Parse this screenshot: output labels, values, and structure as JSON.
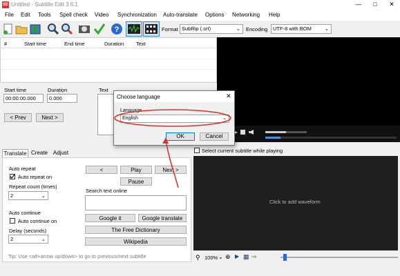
{
  "window": {
    "title": "Untitled - Subtitle Edit 3.6.1"
  },
  "menu": [
    "File",
    "Edit",
    "Tools",
    "Spell check",
    "Video",
    "Synchronization",
    "Auto-translate",
    "Options",
    "Networking",
    "Help"
  ],
  "toolbar": {
    "format_label": "Format",
    "format_value": "SubRip (.srt)",
    "encoding_label": "Encoding",
    "encoding_value": "UTF-8 with BOM",
    "icons": [
      "new-file-icon",
      "open-folder-icon",
      "save-icon",
      "find-icon",
      "replace-icon",
      "visual-sync-icon",
      "spell-check-icon",
      "help-icon",
      "waveform-icon",
      "video-icon"
    ]
  },
  "grid": {
    "columns": [
      "#",
      "Start time",
      "End time",
      "Duration",
      "Text"
    ]
  },
  "editor": {
    "start_time_label": "Start time",
    "duration_label": "Duration",
    "text_label": "Text",
    "start_time_value": "00:00:00.000",
    "duration_value": "0.000",
    "prev_label": "< Prev",
    "next_label": "Next >"
  },
  "dialog": {
    "title": "Choose language",
    "language_label": "Language",
    "language_value": "English",
    "ok_label": "OK",
    "cancel_label": "Cancel"
  },
  "tabs": [
    "Translate",
    "Create",
    "Adjust"
  ],
  "translate": {
    "auto_repeat_group": "Auto repeat",
    "auto_repeat_on": "Auto repeat on",
    "repeat_count_label": "Repeat count (times)",
    "repeat_count_value": "2",
    "auto_continue_group": "Auto continue",
    "auto_continue_on": "Auto continue on",
    "delay_label": "Delay (seconds)",
    "delay_value": "2",
    "prev_btn": "<",
    "play_btn": "Play",
    "next_btn": "Next >",
    "pause_btn": "Pause",
    "search_label": "Search text online",
    "google_it": "Google it",
    "google_translate": "Google translate",
    "free_dictionary": "The Free Dictionary",
    "wikipedia": "Wikipedia",
    "tip": "Tip: Use <alt+arrow up/down> to go to previous/next subtitle"
  },
  "waveform": {
    "select_current": "Select current subtitle while playing",
    "click_to_add": "Click to add waveform",
    "zoom": "100%"
  },
  "video": {
    "time": "-:-- / -:--"
  },
  "colors": {
    "accent": "#0078d7",
    "annotation": "#d9342b",
    "video_bg": "#000000",
    "wave_bg": "#1e1e1e"
  }
}
